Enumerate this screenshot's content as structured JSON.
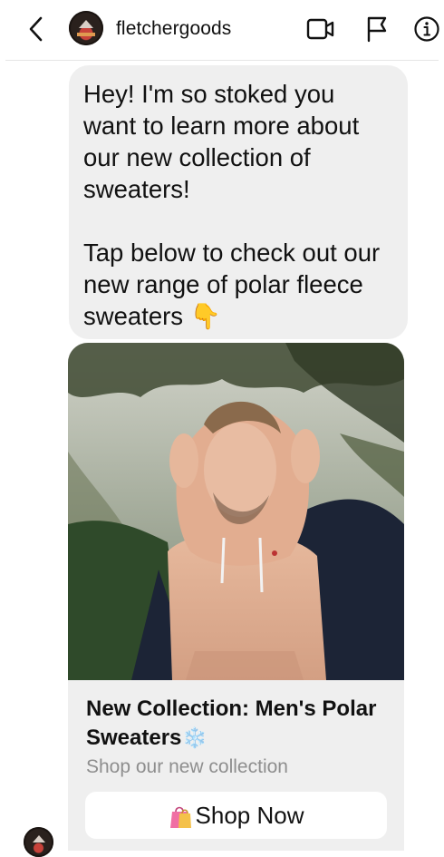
{
  "header": {
    "username": "fletchergoods",
    "icons": [
      "back-icon",
      "video-call-icon",
      "flag-icon",
      "info-icon"
    ]
  },
  "message": {
    "text": "Hey! I'm so stoked you want to learn more about our new collection of sweaters!\n\nTap below to check out our new range of polar fleece sweaters 👇"
  },
  "card": {
    "title": "New Collection: Men's Polar Sweaters",
    "title_emoji": "❄️",
    "subtitle": "Shop our new collection",
    "button_label": "Shop Now",
    "button_emoji": "🛍️"
  },
  "colors": {
    "bubble_bg": "#efefef",
    "subtitle": "#8e8e8e",
    "text": "#111111"
  }
}
